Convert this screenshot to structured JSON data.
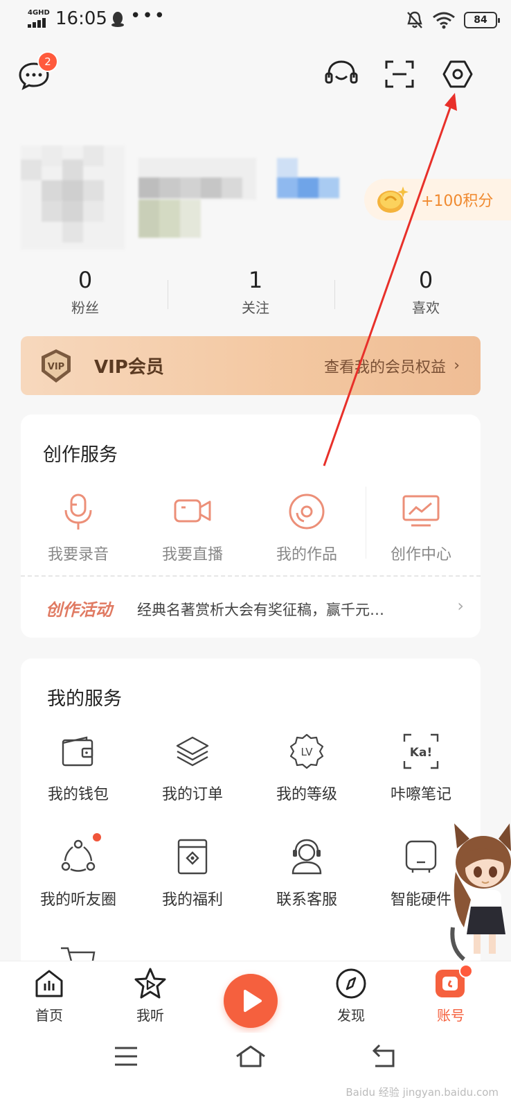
{
  "status_bar": {
    "network": "4GHD",
    "time": "16:05",
    "more": "•••",
    "battery": "84"
  },
  "header": {
    "message_badge": "2",
    "icons": [
      "message-icon",
      "headset-icon",
      "scan-icon",
      "settings-icon"
    ]
  },
  "profile": {
    "points_label": "+100积分"
  },
  "stats": [
    {
      "value": "0",
      "label": "粉丝"
    },
    {
      "value": "1",
      "label": "关注"
    },
    {
      "value": "0",
      "label": "喜欢"
    }
  ],
  "vip": {
    "badge": "VIP",
    "title": "VIP会员",
    "link": "查看我的会员权益",
    "chevron": "›"
  },
  "create": {
    "title": "创作服务",
    "items": [
      {
        "label": "我要录音",
        "icon": "microphone-icon"
      },
      {
        "label": "我要直播",
        "icon": "video-camera-icon"
      },
      {
        "label": "我的作品",
        "icon": "disc-icon"
      },
      {
        "label": "创作中心",
        "icon": "monitor-chart-icon"
      }
    ],
    "activity_tag": "创作活动",
    "activity_text": "经典名著赏析大会有奖征稿，赢千元…",
    "activity_chevron": "›"
  },
  "services": {
    "title": "我的服务",
    "items": [
      {
        "label": "我的钱包",
        "icon": "wallet-icon"
      },
      {
        "label": "我的订单",
        "icon": "layers-icon"
      },
      {
        "label": "我的等级",
        "icon": "level-badge-icon",
        "icon_text": "LV"
      },
      {
        "label": "咔嚓笔记",
        "icon": "ka-note-icon",
        "icon_text": "Ka!"
      },
      {
        "label": "我的听友圈",
        "icon": "circle-nodes-icon"
      },
      {
        "label": "我的福利",
        "icon": "gift-box-icon"
      },
      {
        "label": "联系客服",
        "icon": "customer-service-icon"
      },
      {
        "label": "智能硬件",
        "icon": "smart-speaker-icon"
      }
    ]
  },
  "tabbar": {
    "items": [
      {
        "label": "首页",
        "icon": "home-icon"
      },
      {
        "label": "我听",
        "icon": "star-play-icon"
      },
      {
        "label": "发现",
        "icon": "compass-icon"
      },
      {
        "label": "账号",
        "icon": "account-icon"
      }
    ]
  },
  "watermark": "Baidu 经验 jingyan.baidu.com",
  "colors": {
    "accent": "#f5603e",
    "vip_gradient_start": "#f7d8bd",
    "annotation_arrow": "#e8302a"
  }
}
